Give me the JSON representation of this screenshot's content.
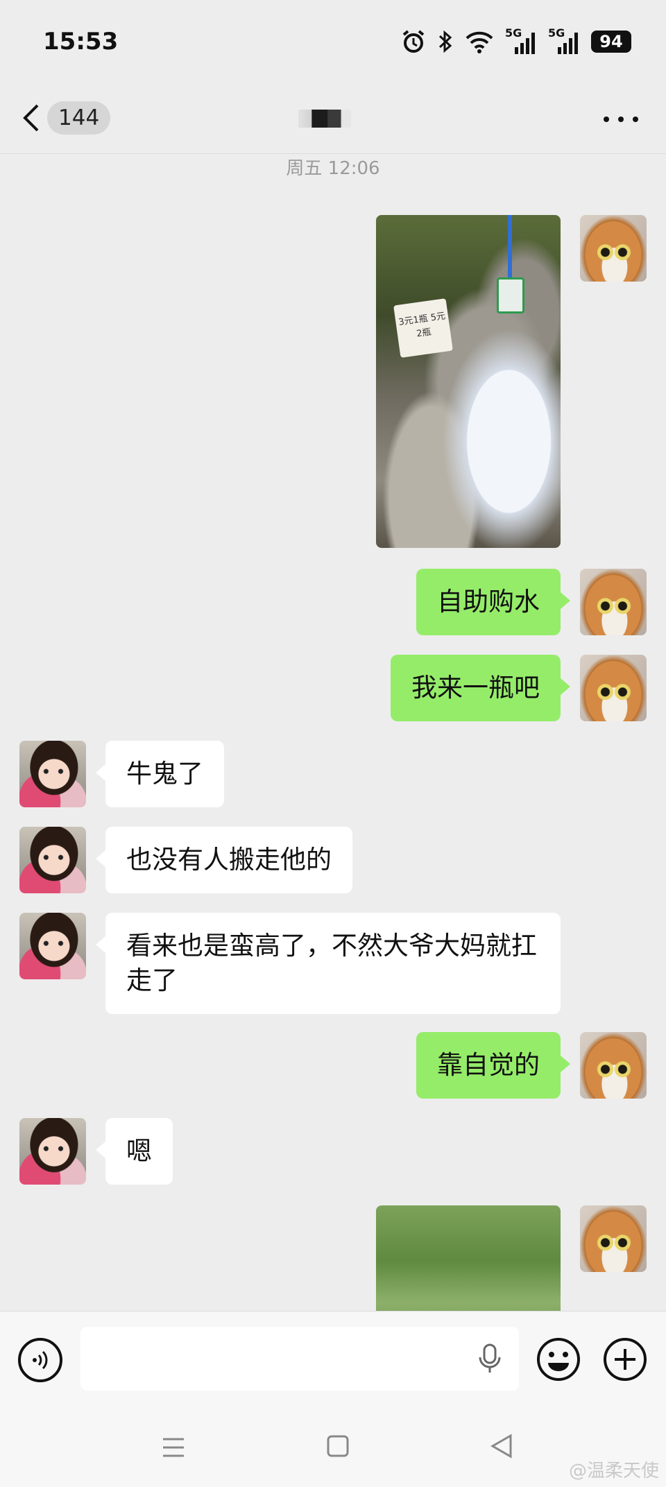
{
  "status_bar": {
    "time": "15:53",
    "network_1": "5G",
    "network_2": "5G",
    "battery": "94"
  },
  "header": {
    "unread_count": "144"
  },
  "chat": {
    "timestamp": "周五 12:06",
    "photo_1_sign": "3元1瓶 5元2瓶",
    "messages": [
      {
        "side": "sent",
        "text": "自助购水"
      },
      {
        "side": "sent",
        "text": "我来一瓶吧"
      },
      {
        "side": "recv",
        "text": "牛鬼了"
      },
      {
        "side": "recv",
        "text": "也没有人搬走他的"
      },
      {
        "side": "recv",
        "text": "看来也是蛮高了，不然大爷大妈就扛走了"
      },
      {
        "side": "sent",
        "text": "靠自觉的"
      },
      {
        "side": "recv",
        "text": "嗯"
      }
    ]
  },
  "input": {
    "value": "",
    "placeholder": ""
  },
  "watermark": "@温柔天使",
  "colors": {
    "sent_bubble": "#95ec69",
    "recv_bubble": "#ffffff",
    "background": "#ededed"
  }
}
